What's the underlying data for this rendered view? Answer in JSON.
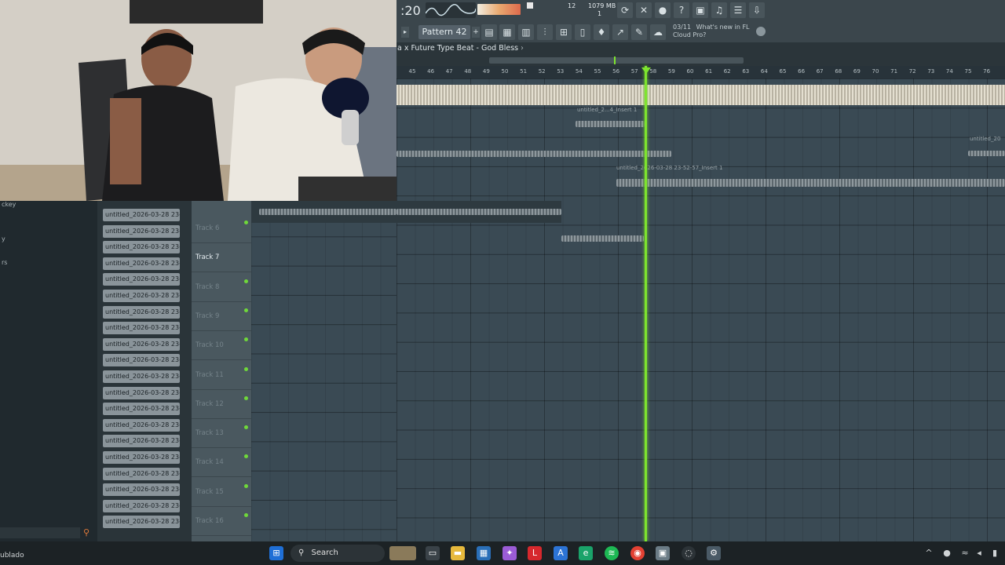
{
  "toolbar": {
    "time": ":20",
    "tempo_digits": "12",
    "memory": "1079 MB",
    "counter": "1",
    "pattern": "Pattern 42",
    "news_date": "03/11",
    "news_text_1": "What's new in FL",
    "news_text_2": "Cloud Pro?"
  },
  "playlist": {
    "title": "a x Future Type Beat - God Bless",
    "ruler": [
      "45",
      "46",
      "47",
      "48",
      "49",
      "50",
      "51",
      "52",
      "53",
      "54",
      "55",
      "56",
      "57",
      "58",
      "59",
      "60",
      "61",
      "62",
      "63",
      "64",
      "65",
      "66",
      "67",
      "68",
      "69",
      "70",
      "71",
      "72",
      "73",
      "74",
      "75",
      "76"
    ]
  },
  "clips_on_grid": {
    "c1": "untitled_2...4_Insert 1",
    "c2": "untitled_2026-03-28 23-52-57_Insert 1",
    "c3": "untitled_20"
  },
  "browser": {
    "labels": [
      "ckey",
      "y",
      "rs"
    ]
  },
  "clip_list": [
    "untitled_2026-03-28 23-...",
    "untitled_2026-03-28 23-...",
    "untitled_2026-03-28 23-...",
    "untitled_2026-03-28 23-...",
    "untitled_2026-03-28 23-...",
    "untitled_2026-03-28 23-...",
    "untitled_2026-03-28 23-...",
    "untitled_2026-03-28 23-...",
    "untitled_2026-03-28 23-...",
    "untitled_2026-03-28 23-...",
    "untitled_2026-03-28 23-...",
    "untitled_2026-03-28 23-...",
    "untitled_2026-03-28 23-...",
    "untitled_2026-03-28 23-...",
    "untitled_2026-03-28 23-...",
    "untitled_2026-03-28 23-...",
    "untitled_2026-03-28 23-...",
    "untitled_2026-03-28 23-...",
    "untitled_2026-03-28 23-...",
    "untitled_2026-03-28 23-..."
  ],
  "tracks": [
    "Track 6",
    "Track 7",
    "Track 8",
    "Track 9",
    "Track 10",
    "Track 11",
    "Track 12",
    "Track 13",
    "Track 14",
    "Track 15",
    "Track 16"
  ],
  "taskbar": {
    "search": "Search",
    "status_left": "ublado"
  },
  "colors": {
    "playhead": "#7ee52e",
    "accent": "#6fd83a"
  }
}
